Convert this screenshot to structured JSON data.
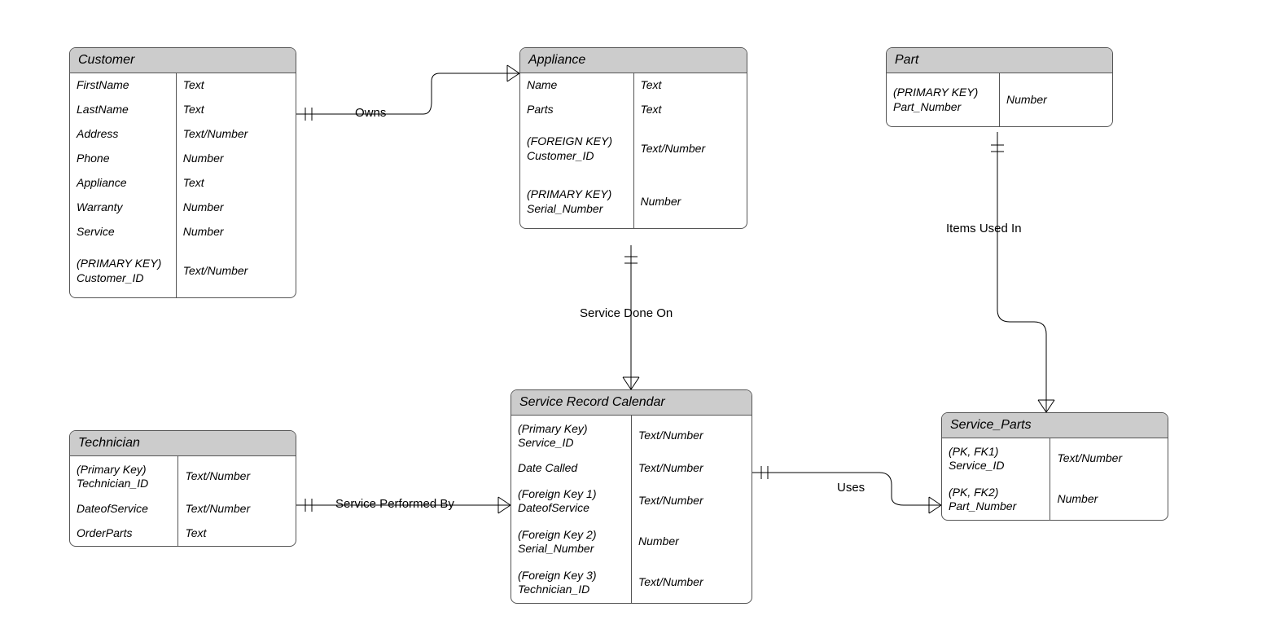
{
  "entities": {
    "customer": {
      "title": "Customer",
      "rows": [
        {
          "l": "FirstName",
          "r": "Text"
        },
        {
          "l": "LastName",
          "r": "Text"
        },
        {
          "l": "Address",
          "r": "Text/Number"
        },
        {
          "l": "Phone",
          "r": "Number"
        },
        {
          "l": "Appliance",
          "r": "Text"
        },
        {
          "l": "Warranty",
          "r": "Number"
        },
        {
          "l": "Service",
          "r": "Number"
        },
        {
          "l": "(PRIMARY KEY) Customer_ID",
          "r": "Text/Number"
        }
      ]
    },
    "appliance": {
      "title": "Appliance",
      "rows": [
        {
          "l": "Name",
          "r": "Text"
        },
        {
          "l": "Parts",
          "r": "Text"
        },
        {
          "l": "(FOREIGN KEY) Customer_ID",
          "r": "Text/Number"
        },
        {
          "l": "(PRIMARY KEY) Serial_Number",
          "r": "Number"
        }
      ]
    },
    "part": {
      "title": "Part",
      "rows": [
        {
          "l": "(PRIMARY KEY) Part_Number",
          "r": "Number"
        }
      ]
    },
    "technician": {
      "title": "Technician",
      "rows": [
        {
          "l": "(Primary Key) Technician_ID",
          "r": "Text/Number"
        },
        {
          "l": "DateofService",
          "r": "Text/Number"
        },
        {
          "l": "OrderParts",
          "r": "Text"
        }
      ]
    },
    "service_record": {
      "title": "Service Record Calendar",
      "rows": [
        {
          "l": "(Primary Key) Service_ID",
          "r": "Text/Number"
        },
        {
          "l": "Date Called",
          "r": "Text/Number"
        },
        {
          "l": "(Foreign Key 1) DateofService",
          "r": "Text/Number"
        },
        {
          "l": "(Foreign Key 2) Serial_Number",
          "r": "Number"
        },
        {
          "l": "(Foreign Key 3) Technician_ID",
          "r": "Text/Number"
        }
      ]
    },
    "service_parts": {
      "title": "Service_Parts",
      "rows": [
        {
          "l": "(PK, FK1) Service_ID",
          "r": "Text/Number"
        },
        {
          "l": "(PK, FK2) Part_Number",
          "r": "Number"
        }
      ]
    }
  },
  "relationships": {
    "owns": "Owns",
    "service_done_on": "Service Done On",
    "items_used_in": "Items Used In",
    "service_performed_by": "Service Performed By",
    "uses": "Uses"
  }
}
